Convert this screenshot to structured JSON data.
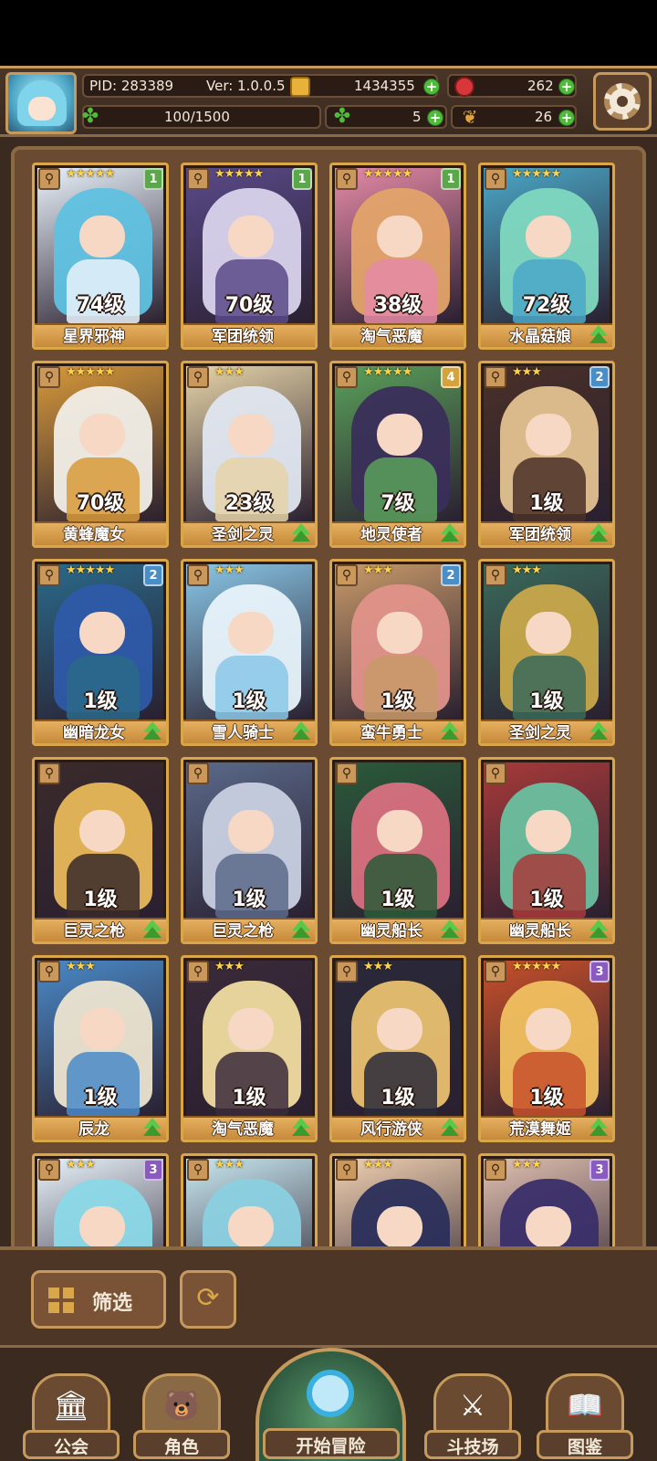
{
  "header": {
    "pid_text": "PID: 283389",
    "version_text": "Ver: 1.0.0.5",
    "gold": "1434355",
    "meat": "262",
    "clover": "5",
    "leaf": "26",
    "stamina": "100/1500"
  },
  "heroes": [
    {
      "name": "星界邪神",
      "level": "74级",
      "stars": "★★★★★",
      "rank": "1",
      "rank_color": "green",
      "hair": "#5fc1e0",
      "body": "#e9f3fb",
      "upgrade": false
    },
    {
      "name": "军团统领",
      "level": "70级",
      "stars": "★★★★★",
      "rank": "1",
      "rank_color": "green",
      "hair": "#d9d3ec",
      "body": "#5a4a8a",
      "upgrade": false
    },
    {
      "name": "淘气恶魔",
      "level": "38级",
      "stars": "★★★★★",
      "rank": "1",
      "rank_color": "green",
      "hair": "#e3a36a",
      "body": "#e58aa6",
      "upgrade": false
    },
    {
      "name": "水晶菇娘",
      "level": "72级",
      "stars": "★★★★★",
      "rank": "",
      "rank_color": "",
      "hair": "#7fd8c0",
      "body": "#4aa8c8",
      "upgrade": true
    },
    {
      "name": "黄蜂魔女",
      "level": "70级",
      "stars": "★★★★★",
      "rank": "",
      "rank_color": "",
      "hair": "#f1eee8",
      "body": "#d89a3a",
      "upgrade": false
    },
    {
      "name": "圣剑之灵",
      "level": "23级",
      "stars": "★★★",
      "rank": "",
      "rank_color": "",
      "hair": "#dfe6f0",
      "body": "#e6d4a8",
      "upgrade": true
    },
    {
      "name": "地灵使者",
      "level": "7级",
      "stars": "★★★★★",
      "rank": "4",
      "rank_color": "gold",
      "hair": "#3a2e5a",
      "body": "#5aa05a",
      "upgrade": true
    },
    {
      "name": "军团统领",
      "level": "1级",
      "stars": "★★★",
      "rank": "2",
      "rank_color": "blue",
      "hair": "#e3c290",
      "body": "#4a3028",
      "upgrade": true
    },
    {
      "name": "幽暗龙女",
      "level": "1级",
      "stars": "★★★★★",
      "rank": "2",
      "rank_color": "blue",
      "hair": "#2e5aa8",
      "body": "#2a6a8a",
      "upgrade": true
    },
    {
      "name": "雪人骑士",
      "level": "1级",
      "stars": "★★★",
      "rank": "",
      "rank_color": "",
      "hair": "#e8f3fb",
      "body": "#8ac8e8",
      "upgrade": true
    },
    {
      "name": "蛮牛勇士",
      "level": "1级",
      "stars": "★★★",
      "rank": "2",
      "rank_color": "blue",
      "hair": "#e0928a",
      "body": "#c89a6a",
      "upgrade": true
    },
    {
      "name": "圣剑之灵",
      "level": "1级",
      "stars": "★★★",
      "rank": "",
      "rank_color": "",
      "hair": "#c8a84a",
      "body": "#3a6a5a",
      "upgrade": true
    },
    {
      "name": "巨灵之枪",
      "level": "1级",
      "stars": "",
      "rank": "",
      "rank_color": "",
      "hair": "#e8b85a",
      "body": "#3a2a2a",
      "upgrade": true
    },
    {
      "name": "巨灵之枪",
      "level": "1级",
      "stars": "",
      "rank": "",
      "rank_color": "",
      "hair": "#c8d0e0",
      "body": "#5a6a8a",
      "upgrade": true
    },
    {
      "name": "幽灵船长",
      "level": "1级",
      "stars": "",
      "rank": "",
      "rank_color": "",
      "hair": "#d87080",
      "body": "#2a5a3a",
      "upgrade": true
    },
    {
      "name": "幽灵船长",
      "level": "1级",
      "stars": "",
      "rank": "",
      "rank_color": "",
      "hair": "#6ac0a0",
      "body": "#a83a3a",
      "upgrade": true
    },
    {
      "name": "辰龙",
      "level": "1级",
      "stars": "★★★",
      "rank": "",
      "rank_color": "",
      "hair": "#ece4d0",
      "body": "#4a8ac8",
      "upgrade": true
    },
    {
      "name": "淘气恶魔",
      "level": "1级",
      "stars": "★★★",
      "rank": "",
      "rank_color": "",
      "hair": "#f0dca0",
      "body": "#3a2a3a",
      "upgrade": true
    },
    {
      "name": "风行游侠",
      "level": "1级",
      "stars": "★★★",
      "rank": "",
      "rank_color": "",
      "hair": "#e8c070",
      "body": "#2a2a3a",
      "upgrade": true
    },
    {
      "name": "荒漠舞姬",
      "level": "1级",
      "stars": "★★★★★",
      "rank": "3",
      "rank_color": "purple",
      "hair": "#f0c060",
      "body": "#c8502a",
      "upgrade": true
    },
    {
      "name": "",
      "level": "",
      "stars": "★★★",
      "rank": "3",
      "rank_color": "purple",
      "hair": "#8ad8e8",
      "body": "#e8f3fb",
      "upgrade": false
    },
    {
      "name": "",
      "level": "",
      "stars": "★★★",
      "rank": "",
      "rank_color": "",
      "hair": "#8ad0e0",
      "body": "#c8e8f0",
      "upgrade": false
    },
    {
      "name": "",
      "level": "",
      "stars": "★★★",
      "rank": "",
      "rank_color": "",
      "hair": "#2a2e5a",
      "body": "#f0d0b0",
      "upgrade": false
    },
    {
      "name": "",
      "level": "",
      "stars": "★★★",
      "rank": "3",
      "rank_color": "purple",
      "hair": "#3a2e6a",
      "body": "#e0c0b0",
      "upgrade": false
    }
  ],
  "filter": {
    "label": "筛选"
  },
  "nav": {
    "guild": "公会",
    "characters": "角色",
    "adventure": "开始冒险",
    "arena": "斗技场",
    "codex": "图鉴"
  }
}
